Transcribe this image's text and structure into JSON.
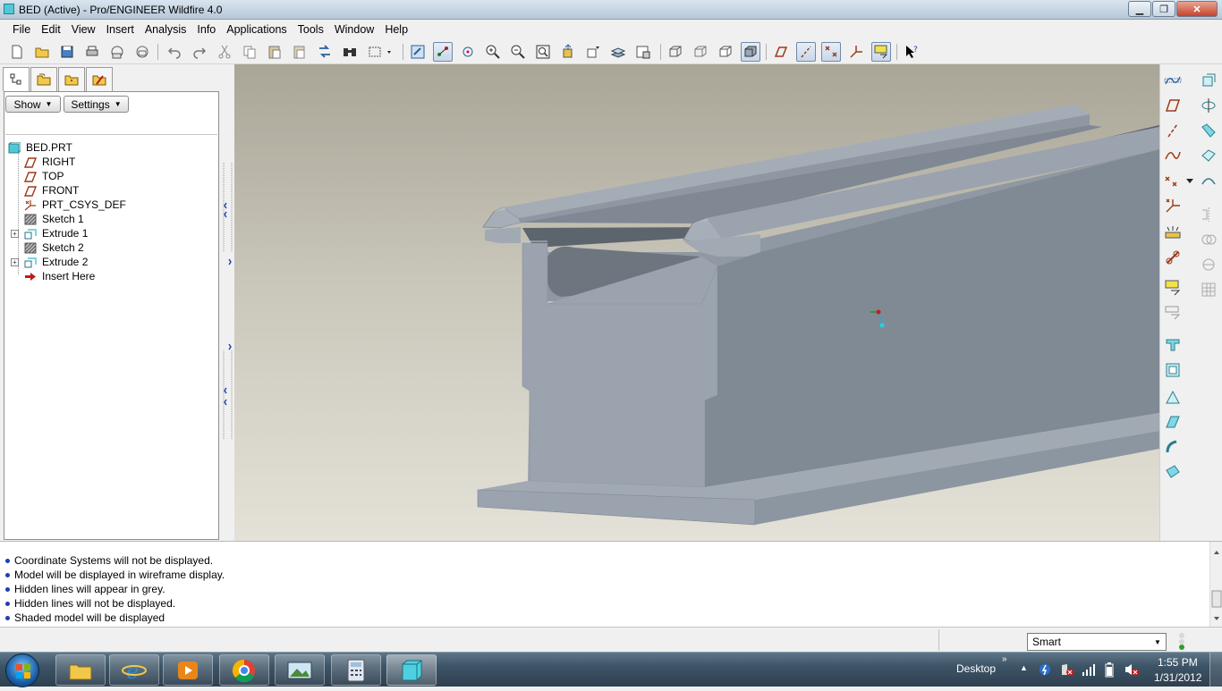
{
  "window": {
    "title": "BED (Active) - Pro/ENGINEER Wildfire 4.0",
    "minimize_label": "▁",
    "maximize_label": "❐",
    "close_label": "✕"
  },
  "menu": {
    "items": [
      "File",
      "Edit",
      "View",
      "Insert",
      "Analysis",
      "Info",
      "Applications",
      "Tools",
      "Window",
      "Help"
    ]
  },
  "toolbar": {
    "icons": [
      "new-icon",
      "open-icon",
      "save-icon",
      "print-icon",
      "email-icon",
      "email-link-icon",
      "undo-icon",
      "redo-icon",
      "cut-icon",
      "copy-icon",
      "paste-icon",
      "paste-special-icon",
      "regenerate-icon",
      "select-box-icon",
      "repaint-icon",
      "spin-center-icon",
      "orient-mode-icon",
      "zoom-in-icon",
      "zoom-out-icon",
      "refit-icon",
      "reorient-icon",
      "saved-views-icon",
      "layers-icon",
      "view-manager-icon",
      "wireframe-icon",
      "hidden-line-icon",
      "no-hidden-icon",
      "shaded-icon",
      "datum-planes-icon",
      "datum-axes-icon",
      "datum-points-icon",
      "coordinate-systems-icon",
      "annotations-icon",
      "context-help-icon"
    ]
  },
  "model_tree": {
    "show_label": "Show",
    "settings_label": "Settings",
    "nodes": [
      {
        "label": "BED.PRT",
        "icon": "part-icon"
      },
      {
        "label": "RIGHT",
        "icon": "datum-plane-icon"
      },
      {
        "label": "TOP",
        "icon": "datum-plane-icon"
      },
      {
        "label": "FRONT",
        "icon": "datum-plane-icon"
      },
      {
        "label": "PRT_CSYS_DEF",
        "icon": "csys-icon"
      },
      {
        "label": "Sketch 1",
        "icon": "sketch-icon"
      },
      {
        "label": "Extrude 1",
        "icon": "extrude-icon"
      },
      {
        "label": "Sketch 2",
        "icon": "sketch-icon"
      },
      {
        "label": "Extrude 2",
        "icon": "extrude-icon"
      },
      {
        "label": "Insert Here",
        "icon": "insert-arrow-icon"
      }
    ]
  },
  "messages": [
    "Coordinate Systems will not be displayed.",
    "Model will be displayed in wireframe display.",
    "Hidden lines will appear in grey.",
    "Hidden lines will not be displayed.",
    "Shaded model will be displayed"
  ],
  "status": {
    "filter_value": "Smart"
  },
  "taskbar": {
    "desktop_label": "Desktop",
    "time": "1:55 PM",
    "date": "1/31/2012",
    "apps": [
      "explorer-icon",
      "internet-explorer-icon",
      "media-player-icon",
      "chrome-icon",
      "image-viewer-icon",
      "calculator-icon",
      "proengineer-icon"
    ]
  },
  "colors": {
    "viewport_top": "#a9a597",
    "viewport_bottom": "#e4e2d8",
    "model_face": "#9aa3ae",
    "model_dark": "#7e8894",
    "accent_blue": "#1d3fae"
  }
}
